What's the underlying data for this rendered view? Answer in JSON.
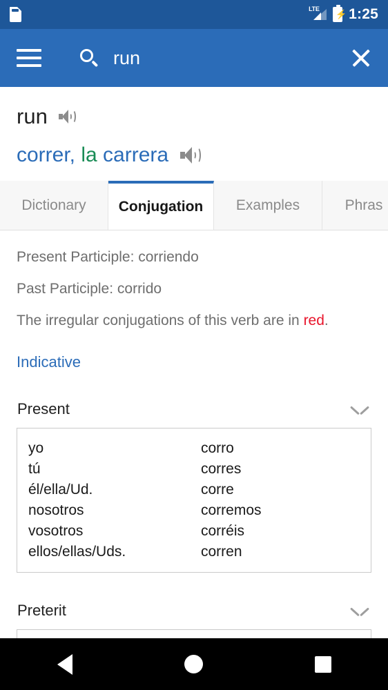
{
  "status_bar": {
    "sd_icon": "sd-card-icon",
    "network_label": "LTE",
    "signal_icon": "signal-bars-icon",
    "battery_icon": "battery-charging-icon",
    "time": "1:25"
  },
  "app_bar": {
    "menu_icon": "hamburger-menu-icon",
    "search_icon": "search-icon",
    "search_value": "run",
    "search_placeholder": "Search",
    "close_icon": "close-icon"
  },
  "entry": {
    "headword": "run",
    "headword_audio_icon": "speaker-icon",
    "translation_parts": [
      {
        "text": "correr, ",
        "color": "#2b6cb8"
      },
      {
        "text": "la ",
        "color": "#1a8c56"
      },
      {
        "text": "carrera",
        "color": "#2b6cb8"
      }
    ],
    "translation_audio_icon": "speaker-icon"
  },
  "tabs": [
    {
      "label": "Dictionary",
      "active": false
    },
    {
      "label": "Conjugation",
      "active": true
    },
    {
      "label": "Examples",
      "active": false
    },
    {
      "label": "Phras",
      "active": false
    }
  ],
  "conjugation": {
    "present_participle": "Present Participle: corriendo",
    "past_participle": "Past Participle: corrido",
    "irregular_note_prefix": "The irregular conjugations of this verb are in ",
    "irregular_note_highlight": "red",
    "irregular_note_suffix": ".",
    "highlight_color": "#e8152b",
    "mood_link": "Indicative",
    "tenses": [
      {
        "title": "Present",
        "chevron_icon": "chevron-down-icon",
        "rows": [
          {
            "pronoun": "yo",
            "form": "corro"
          },
          {
            "pronoun": "tú",
            "form": "corres"
          },
          {
            "pronoun": "él/ella/Ud.",
            "form": "corre"
          },
          {
            "pronoun": "nosotros",
            "form": "corremos"
          },
          {
            "pronoun": "vosotros",
            "form": "corréis"
          },
          {
            "pronoun": "ellos/ellas/Uds.",
            "form": "corren"
          }
        ]
      },
      {
        "title": "Preterit",
        "chevron_icon": "chevron-down-icon",
        "rows": []
      }
    ]
  },
  "nav_bar": {
    "back_icon": "back-triangle-icon",
    "home_icon": "home-circle-icon",
    "recents_icon": "recents-square-icon"
  },
  "colors": {
    "status_bar": "#1e5799",
    "app_bar": "#2b6cb8",
    "accent": "#2b6cb8",
    "green": "#1a8c56",
    "red": "#e8152b"
  }
}
